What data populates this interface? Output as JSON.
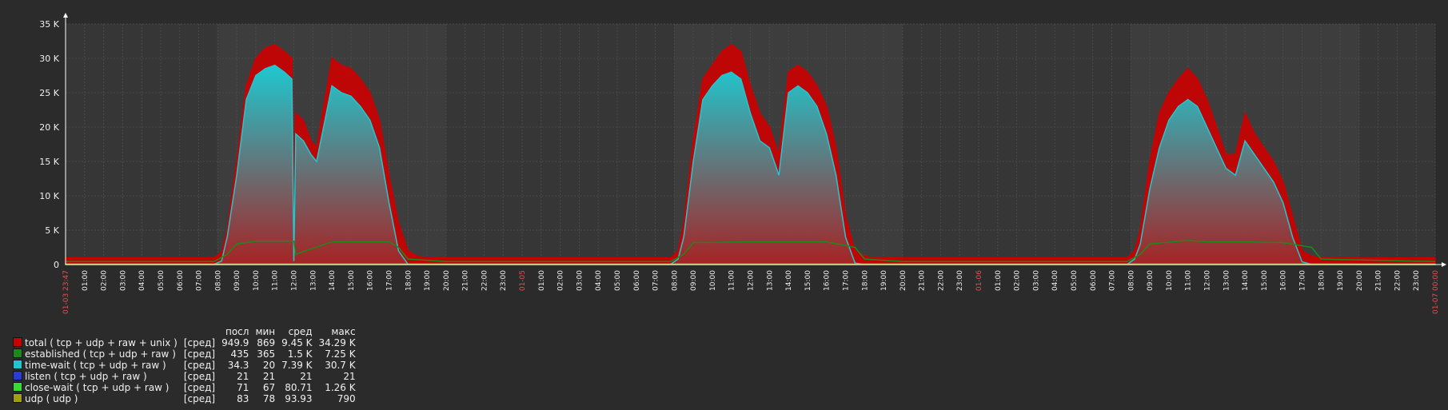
{
  "chart_data": {
    "type": "area",
    "y_ticks": [
      "0",
      "5 K",
      "10 K",
      "15 K",
      "20 K",
      "25 K",
      "30 K",
      "35 K"
    ],
    "ylim": [
      0,
      35000
    ],
    "x_tick_labels": [
      "01-03 23:47",
      "01:00",
      "02:00",
      "03:00",
      "04:00",
      "05:00",
      "06:00",
      "07:00",
      "08:00",
      "09:00",
      "10:00",
      "11:00",
      "12:00",
      "13:00",
      "14:00",
      "15:00",
      "16:00",
      "17:00",
      "18:00",
      "19:00",
      "20:00",
      "21:00",
      "22:00",
      "23:00",
      "01-05",
      "01:00",
      "02:00",
      "03:00",
      "04:00",
      "05:00",
      "06:00",
      "07:00",
      "08:00",
      "09:00",
      "10:00",
      "11:00",
      "12:00",
      "13:00",
      "14:00",
      "15:00",
      "16:00",
      "17:00",
      "18:00",
      "19:00",
      "20:00",
      "21:00",
      "22:00",
      "23:00",
      "01-06",
      "01:00",
      "02:00",
      "03:00",
      "04:00",
      "05:00",
      "06:00",
      "07:00",
      "08:00",
      "09:00",
      "10:00",
      "11:00",
      "12:00",
      "13:00",
      "14:00",
      "15:00",
      "16:00",
      "17:00",
      "18:00",
      "19:00",
      "20:00",
      "21:00",
      "22:00",
      "23:00",
      "01-07 00:00"
    ],
    "highlight_labels": [
      "01-03 23:47",
      "01-05",
      "01-06",
      "01-07 00:00"
    ],
    "x_hours": [
      0,
      1,
      2,
      3,
      4,
      5,
      6,
      7,
      8,
      9,
      10,
      11,
      12,
      13,
      14,
      15,
      16,
      17,
      18,
      19,
      20,
      21,
      22,
      23,
      24,
      25,
      26,
      27,
      28,
      29,
      30,
      31,
      32,
      33,
      34,
      35,
      36,
      37,
      38,
      39,
      40,
      41,
      42,
      43,
      44,
      45,
      46,
      47,
      48,
      49,
      50,
      51,
      52,
      53,
      54,
      55,
      56,
      57,
      58,
      59,
      60,
      61,
      62,
      63,
      64,
      65,
      66,
      67,
      68,
      69,
      70,
      71,
      72
    ],
    "work_bands": [
      [
        8,
        20
      ],
      [
        32,
        44
      ],
      [
        56,
        68
      ]
    ],
    "series": [
      {
        "name": "total ( tcp + udp + raw + unix )",
        "color": "#cc0000",
        "x": [
          0,
          7.8,
          8.2,
          8.5,
          9,
          9.5,
          10,
          10.5,
          11,
          11.5,
          11.9,
          12,
          12.1,
          12.5,
          12.9,
          13.2,
          14,
          14.5,
          15,
          15.5,
          16,
          16.5,
          17,
          17.5,
          18,
          18.5,
          19,
          20,
          31.8,
          32.2,
          32.5,
          33,
          33.5,
          34,
          34.5,
          35,
          35.5,
          36,
          36.5,
          37,
          37.5,
          38,
          38.5,
          39,
          39.5,
          40,
          40.5,
          41,
          41.5,
          42,
          42.5,
          43,
          44,
          55.8,
          56.2,
          56.5,
          57,
          57.5,
          58,
          58.5,
          59,
          59.5,
          60,
          60.5,
          61,
          61.5,
          62,
          62.5,
          63,
          63.5,
          64,
          64.5,
          65,
          65.5,
          66,
          66.5,
          67,
          72
        ],
        "y": [
          950,
          950,
          1800,
          5000,
          15000,
          26000,
          30000,
          31500,
          32000,
          31000,
          30000,
          12000,
          22000,
          21000,
          18000,
          17000,
          30000,
          29000,
          28500,
          27000,
          25000,
          21000,
          13000,
          6000,
          2000,
          1200,
          1000,
          950,
          950,
          2000,
          6000,
          18000,
          27000,
          29000,
          31000,
          32000,
          31000,
          26000,
          22000,
          20000,
          16000,
          28000,
          29000,
          28000,
          26000,
          23000,
          17000,
          7000,
          2000,
          1200,
          1000,
          950,
          950,
          950,
          2000,
          5000,
          15000,
          22000,
          25000,
          27000,
          28500,
          27000,
          24000,
          20000,
          16000,
          16000,
          22000,
          19000,
          17000,
          15000,
          12000,
          7000,
          2000,
          1200,
          1000,
          950,
          950,
          950
        ]
      },
      {
        "name": "established ( tcp + udp  + raw )",
        "color": "#1a8a1a",
        "x": [
          0,
          7.8,
          8.5,
          9,
          10,
          12,
          12.1,
          14,
          17,
          17.5,
          18,
          20,
          31.8,
          32.5,
          33,
          36,
          38,
          40,
          41.5,
          42,
          44,
          55.8,
          56.5,
          57,
          59,
          60,
          62,
          64,
          65.5,
          66,
          72
        ],
        "y": [
          435,
          435,
          1500,
          3000,
          3400,
          3400,
          1500,
          3300,
          3300,
          2500,
          800,
          435,
          435,
          1500,
          3200,
          3300,
          3300,
          3300,
          2500,
          800,
          435,
          435,
          1500,
          3000,
          3500,
          3300,
          3300,
          3200,
          2500,
          800,
          435
        ]
      },
      {
        "name": "time-wait ( tcp + udp  + raw )",
        "color": "#1ec8d0",
        "x": [
          0,
          7.8,
          8.2,
          8.5,
          9,
          9.5,
          10,
          10.5,
          11,
          11.5,
          11.9,
          12,
          12.1,
          12.5,
          12.9,
          13.2,
          14,
          14.5,
          15,
          15.5,
          16,
          16.5,
          17,
          17.5,
          18,
          20,
          31.8,
          32.2,
          32.5,
          33,
          33.5,
          34,
          34.5,
          35,
          35.5,
          36,
          36.5,
          37,
          37.5,
          38,
          38.5,
          39,
          39.5,
          40,
          40.5,
          41,
          41.5,
          42,
          44,
          55.8,
          56.2,
          56.5,
          57,
          57.5,
          58,
          58.5,
          59,
          59.5,
          60,
          60.5,
          61,
          61.5,
          62,
          62.5,
          63,
          63.5,
          64,
          64.5,
          65,
          65.5,
          66,
          72
        ],
        "y": [
          34,
          34,
          500,
          4000,
          13000,
          24000,
          27500,
          28500,
          29000,
          28000,
          27000,
          500,
          19000,
          18000,
          16000,
          15000,
          26000,
          25000,
          24500,
          23000,
          21000,
          17000,
          9000,
          2000,
          34,
          34,
          34,
          800,
          4000,
          15000,
          24000,
          26000,
          27500,
          28000,
          27000,
          22000,
          18000,
          17000,
          13000,
          25000,
          26000,
          25000,
          23000,
          19000,
          13000,
          4000,
          200,
          34,
          34,
          34,
          800,
          3000,
          11000,
          17000,
          21000,
          23000,
          24000,
          23000,
          20000,
          17000,
          14000,
          13000,
          18000,
          16000,
          14000,
          12000,
          9000,
          4000,
          400,
          34,
          34,
          34
        ]
      },
      {
        "name": "listen ( tcp + udp  + raw )",
        "color": "#2b3bd6",
        "x": [
          0,
          72
        ],
        "y": [
          21,
          21
        ]
      },
      {
        "name": "close-wait ( tcp + udp  + raw )",
        "color": "#33dd33",
        "x": [
          0,
          72
        ],
        "y": [
          75,
          75
        ]
      },
      {
        "name": "udp ( udp )",
        "color": "#a0a010",
        "x": [
          0,
          72
        ],
        "y": [
          85,
          85
        ]
      }
    ]
  },
  "legend": {
    "headers": [
      "посл",
      "мин",
      "сред",
      "макс"
    ],
    "rows": [
      {
        "label": "total ( tcp + udp + raw + unix )",
        "func": "[сред]",
        "last": "949.9",
        "min": "869",
        "avg": "9.45 K",
        "max": "34.29 K"
      },
      {
        "label": "established ( tcp + udp  + raw )",
        "func": "[сред]",
        "last": "435",
        "min": "365",
        "avg": "1.5 K",
        "max": "7.25 K"
      },
      {
        "label": "time-wait ( tcp + udp  + raw )",
        "func": "[сред]",
        "last": "34.3",
        "min": "20",
        "avg": "7.39 K",
        "max": "30.7 K"
      },
      {
        "label": "listen ( tcp + udp  + raw )",
        "func": "[сред]",
        "last": "21",
        "min": "21",
        "avg": "21",
        "max": "21"
      },
      {
        "label": "close-wait ( tcp + udp  + raw )",
        "func": "[сред]",
        "last": "71",
        "min": "67",
        "avg": "80.71",
        "max": "1.26 K"
      },
      {
        "label": "udp ( udp )",
        "func": "[сред]",
        "last": "83",
        "min": "78",
        "avg": "93.93",
        "max": "790"
      }
    ]
  },
  "colors": {
    "background": "#2b2b2b",
    "plot_bg": "#363636",
    "work_bg": "#3d3d3d",
    "grid": "#4a4a4a",
    "highlight": "#e05050",
    "tick": "#f0f0f0"
  }
}
